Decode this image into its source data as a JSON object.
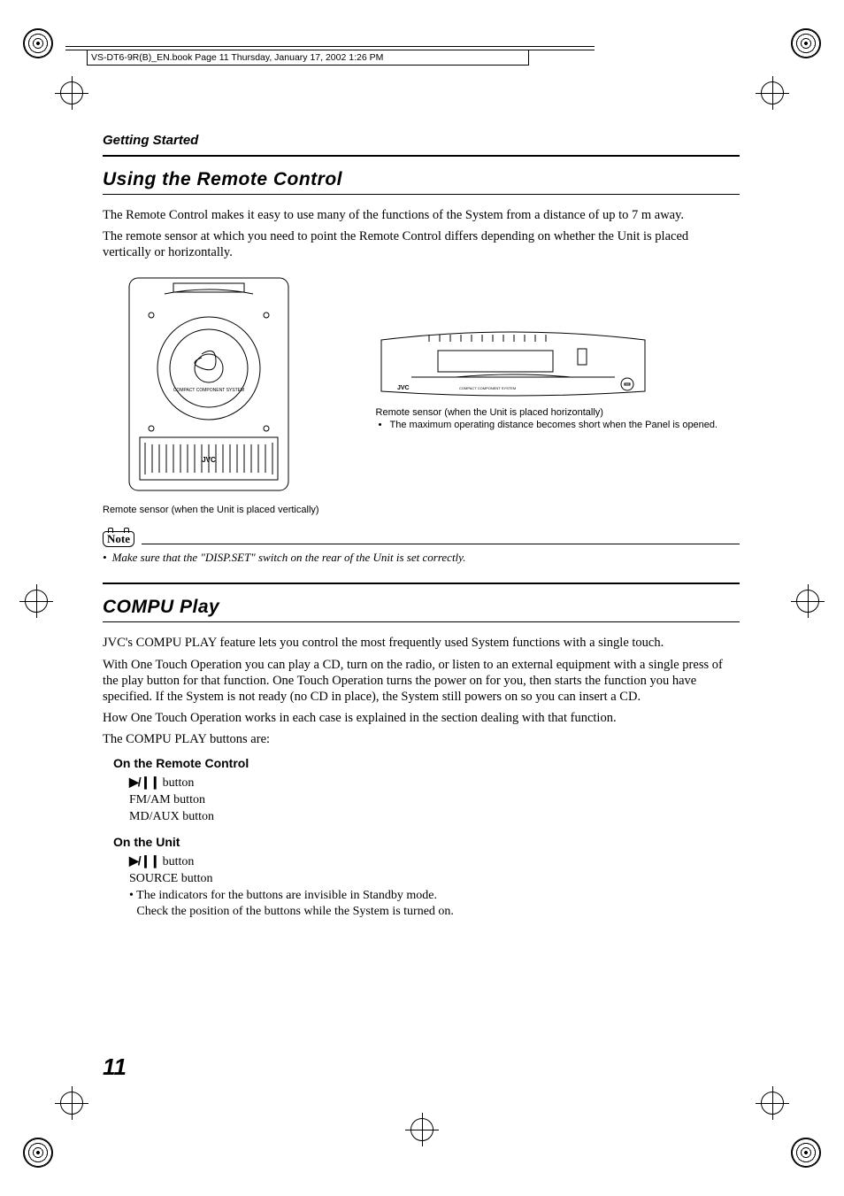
{
  "header": {
    "pathbar": "VS-DT6-9R(B)_EN.book  Page 11  Thursday, January 17, 2002  1:26 PM"
  },
  "chapter": "Getting Started",
  "section1": {
    "title": "Using the Remote Control",
    "p1": "The Remote Control makes it easy to use many of the functions of the System from a distance of up to 7 m away.",
    "p2": "The remote sensor at which you need to point the Remote Control differs depending on whether the Unit is placed vertically or horizontally.",
    "fig_v_caption": "Remote sensor (when the Unit is placed vertically)",
    "fig_h_caption": "Remote sensor (when the Unit is placed horizontally)",
    "fig_h_bullet": "The maximum operating distance becomes short when the Panel is opened.",
    "fig_jvc": "JVC"
  },
  "note": {
    "label": "Note",
    "text": "Make sure that the \"DISP.SET\" switch on the rear of the Unit is set correctly."
  },
  "section2": {
    "title": "COMPU Play",
    "p1": "JVC's COMPU PLAY feature lets you control the most frequently used System functions with a single touch.",
    "p2": "With One Touch Operation you can play a CD, turn on the radio, or listen to an external equipment with a single press of the play button for that function. One Touch Operation turns the power on for you, then starts the function you have specified. If the System is not ready (no CD in place), the System still powers on so you can insert a CD.",
    "p3": "How One Touch Operation works in each case is explained in the section dealing with that function.",
    "p4": "The COMPU PLAY buttons are:",
    "sub_remote": "On the Remote Control",
    "remote_btns": {
      "play": " button",
      "fmam": "FM/AM button",
      "mdaux": "MD/AUX button"
    },
    "sub_unit": "On the Unit",
    "unit_btns": {
      "play": " button",
      "source": "SOURCE button"
    },
    "unit_note_1": "The indicators for the buttons are invisible in Standby mode.",
    "unit_note_2": "Check the position of the buttons while the System is turned on."
  },
  "page_number": "11",
  "glyphs": {
    "playpause": "▶/❙❙"
  }
}
